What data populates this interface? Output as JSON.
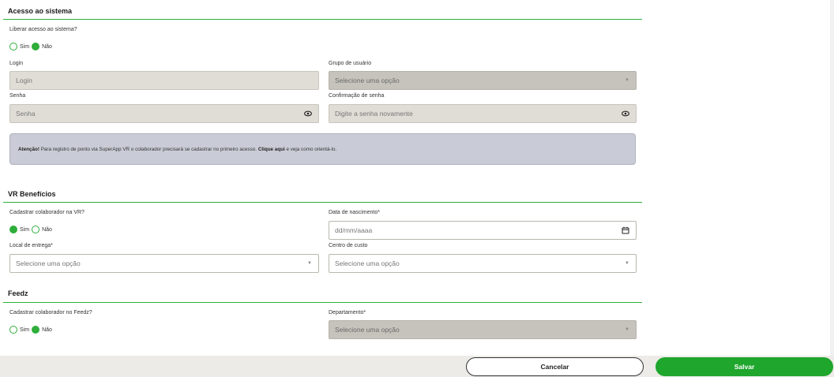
{
  "acesso": {
    "title": "Acesso ao sistema",
    "question": "Liberar acesso ao sistema?",
    "options": {
      "yes": "Sim",
      "no": "Não"
    },
    "selected": "no",
    "login_label": "Login",
    "login_placeholder": "Login",
    "grupo_label": "Grupo de usuário",
    "grupo_placeholder": "Selecione uma opção",
    "senha_label": "Senha",
    "senha_placeholder": "Senha",
    "confirm_label": "Confirmação de senha",
    "confirm_placeholder": "Digite a senha novamente",
    "notice": {
      "bold": "Atenção!",
      "text": " Para registro de ponto via SuperApp VR o colaborador precisará se cadastrar no primeiro acesso. ",
      "link": "Clique aqui",
      "tail": " e veja como orientá-lo."
    }
  },
  "vr": {
    "title": "VR Benefícios",
    "question": "Cadastrar colaborador na VR?",
    "options": {
      "yes": "Sim",
      "no": "Não"
    },
    "selected": "yes",
    "nascimento_label": "Data de nascimento*",
    "nascimento_placeholder": "dd/mm/aaaa",
    "local_label": "Local de entrega*",
    "local_placeholder": "Selecione uma opção",
    "centro_label": "Centro de custo",
    "centro_placeholder": "Selecione uma opção"
  },
  "feedz": {
    "title": "Feedz",
    "question": "Cadastrar colaborador no Feedz?",
    "options": {
      "yes": "Sim",
      "no": "Não"
    },
    "selected": "no",
    "departamento_label": "Departamento*",
    "departamento_placeholder": "Selecione uma opção"
  },
  "footer": {
    "cancel_label": "Cancelar",
    "save_label": "Salvar"
  },
  "colors": {
    "accent": "#2fae3a",
    "save_button": "#1fa62d",
    "notice_bg": "#c9ccd6"
  },
  "icons": {
    "eye": "eye-icon",
    "calendar": "calendar-icon",
    "caret": "chevron-down-icon"
  }
}
